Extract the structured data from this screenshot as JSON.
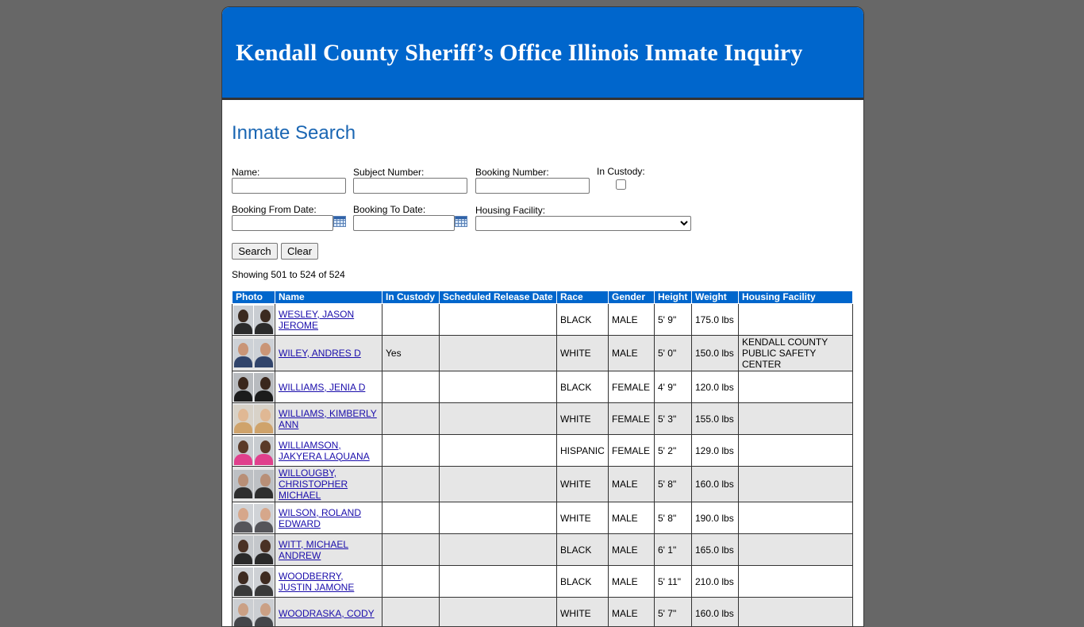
{
  "header": {
    "title": "Kendall County Sheriff’s Office Illinois Inmate Inquiry"
  },
  "page": {
    "title": "Inmate Search"
  },
  "search_form": {
    "name_label": "Name:",
    "subject_number_label": "Subject Number:",
    "booking_number_label": "Booking Number:",
    "in_custody_label": "In Custody:",
    "booking_from_label": "Booking From Date:",
    "booking_to_label": "Booking To Date:",
    "housing_facility_label": "Housing Facility:",
    "search_button": "Search",
    "clear_button": "Clear"
  },
  "results": {
    "showing": "Showing 501 to 524 of 524",
    "columns": [
      "Photo",
      "Name",
      "In Custody",
      "Scheduled Release Date",
      "Race",
      "Gender",
      "Height",
      "Weight",
      "Housing Facility"
    ],
    "rows": [
      {
        "name": "WESLEY, JASON JEROME",
        "in_custody": "",
        "release": "",
        "race": "BLACK",
        "gender": "MALE",
        "height": "5' 9\"",
        "weight": "175.0 lbs",
        "facility": ""
      },
      {
        "name": "WILEY, ANDRES D",
        "in_custody": "Yes",
        "release": "",
        "race": "WHITE",
        "gender": "MALE",
        "height": "5' 0\"",
        "weight": "150.0 lbs",
        "facility": "KENDALL COUNTY PUBLIC SAFETY CENTER"
      },
      {
        "name": "WILLIAMS, JENIA D",
        "in_custody": "",
        "release": "",
        "race": "BLACK",
        "gender": "FEMALE",
        "height": "4' 9\"",
        "weight": "120.0 lbs",
        "facility": ""
      },
      {
        "name": "WILLIAMS, KIMBERLY ANN",
        "in_custody": "",
        "release": "",
        "race": "WHITE",
        "gender": "FEMALE",
        "height": "5' 3\"",
        "weight": "155.0 lbs",
        "facility": ""
      },
      {
        "name": "WILLIAMSON, JAKYERA LAQUANA",
        "in_custody": "",
        "release": "",
        "race": "HISPANIC",
        "gender": "FEMALE",
        "height": "5' 2\"",
        "weight": "129.0 lbs",
        "facility": ""
      },
      {
        "name": "WILLOUGBY, CHRISTOPHER MICHAEL",
        "in_custody": "",
        "release": "",
        "race": "WHITE",
        "gender": "MALE",
        "height": "5' 8\"",
        "weight": "160.0 lbs",
        "facility": ""
      },
      {
        "name": "WILSON, ROLAND EDWARD",
        "in_custody": "",
        "release": "",
        "race": "WHITE",
        "gender": "MALE",
        "height": "5' 8\"",
        "weight": "190.0 lbs",
        "facility": ""
      },
      {
        "name": "WITT, MICHAEL ANDREW",
        "in_custody": "",
        "release": "",
        "race": "BLACK",
        "gender": "MALE",
        "height": "6' 1\"",
        "weight": "165.0 lbs",
        "facility": ""
      },
      {
        "name": "WOODBERRY, JUSTIN JAMONE",
        "in_custody": "",
        "release": "",
        "race": "BLACK",
        "gender": "MALE",
        "height": "5' 11\"",
        "weight": "210.0 lbs",
        "facility": ""
      },
      {
        "name": "WOODRASKA, CODY",
        "in_custody": "",
        "release": "",
        "race": "WHITE",
        "gender": "MALE",
        "height": "5' 7\"",
        "weight": "160.0 lbs",
        "facility": ""
      }
    ]
  },
  "colors": {
    "page_background": "#676767",
    "banner_blue": "#0066cc",
    "title_blue": "#1a66b3",
    "link": "#1a0dab",
    "alt_row": "#e6e6e6"
  },
  "photo_palette": [
    {
      "bg": "#c9cdd2",
      "skin": "#3b2a20",
      "shirt": "#2b2b2b"
    },
    {
      "bg": "#cdd1d6",
      "skin": "#c99577",
      "shirt": "#31446b"
    },
    {
      "bg": "#b8bbbf",
      "skin": "#3a271c",
      "shirt": "#1c1c1c"
    },
    {
      "bg": "#d8d2c8",
      "skin": "#e0b894",
      "shirt": "#cfa36b"
    },
    {
      "bg": "#c8ccd0",
      "skin": "#5a3a28",
      "shirt": "#e0408c"
    },
    {
      "bg": "#bdc0c4",
      "skin": "#b88f77",
      "shirt": "#2e2e2e"
    },
    {
      "bg": "#d0d3d7",
      "skin": "#d6a78b",
      "shirt": "#55555a"
    },
    {
      "bg": "#c4c7cb",
      "skin": "#4a3124",
      "shirt": "#2a2a2a"
    },
    {
      "bg": "#ced1d5",
      "skin": "#3e2b21",
      "shirt": "#3a3a3a"
    },
    {
      "bg": "#cbced2",
      "skin": "#caa085",
      "shirt": "#44464a"
    }
  ]
}
